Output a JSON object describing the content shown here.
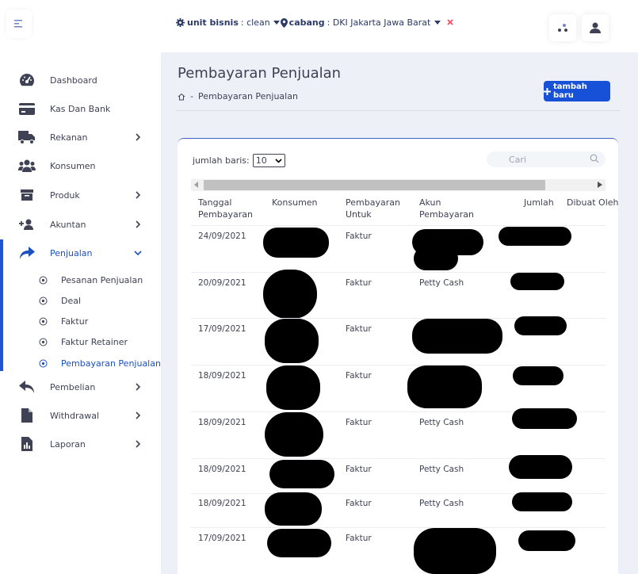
{
  "header": {
    "unit_label": "unit bisnis",
    "unit_value": ": clean",
    "cabang_label": "cabang",
    "cabang_value": ": DKI Jakarta Jawa Barat",
    "clear_icon": "x-icon",
    "apps_icon": "apps-icon",
    "user_icon": "user-icon"
  },
  "sidebar": {
    "toggle_icon": "menu-icon",
    "items": [
      {
        "label": "Dashboard",
        "icon": "gauge-icon"
      },
      {
        "label": "Kas Dan Bank",
        "icon": "card-icon"
      },
      {
        "label": "Rekanan",
        "icon": "truck-icon"
      },
      {
        "label": "Konsumen",
        "icon": "users-icon"
      },
      {
        "label": "Produk",
        "icon": "archive-icon"
      },
      {
        "label": "Akuntan",
        "icon": "user-plus-icon"
      },
      {
        "label": "Penjualan",
        "icon": "share-icon"
      },
      {
        "label": "Pembelian",
        "icon": "reply-icon"
      },
      {
        "label": "Withdrawal",
        "icon": "file-icon"
      },
      {
        "label": "Laporan",
        "icon": "report-icon"
      }
    ],
    "sub_items": [
      {
        "label": "Pesanan Penjualan"
      },
      {
        "label": "Deal"
      },
      {
        "label": "Faktur"
      },
      {
        "label": "Faktur Retainer"
      },
      {
        "label": "Pembayaran Penjualan"
      }
    ]
  },
  "page": {
    "title": "Pembayaran Penjualan",
    "breadcrumb": "Pembayaran Penjualan",
    "add_button": "tambah baru"
  },
  "table": {
    "rows_label": "jumlah baris:",
    "rows_value": "10",
    "search_placeholder": "Cari",
    "columns": {
      "tanggal": "Tanggal\nPembayaran",
      "konsumen": "Konsumen",
      "untuk": "Pembayaran\nUntuk",
      "akun": "Akun\nPembayaran",
      "jumlah": "Jumlah",
      "dibuat": "Dibuat Oleh"
    },
    "rows": [
      {
        "tanggal": "24/09/2021",
        "untuk": "Faktur",
        "akun": ""
      },
      {
        "tanggal": "20/09/2021",
        "untuk": "Faktur",
        "akun": "Petty Cash"
      },
      {
        "tanggal": "17/09/2021",
        "untuk": "Faktur",
        "akun": ""
      },
      {
        "tanggal": "18/09/2021",
        "untuk": "Faktur",
        "akun": ""
      },
      {
        "tanggal": "18/09/2021",
        "untuk": "Faktur",
        "akun": "Petty Cash"
      },
      {
        "tanggal": "18/09/2021",
        "untuk": "Faktur",
        "akun": "Petty Cash"
      },
      {
        "tanggal": "18/09/2021",
        "untuk": "Faktur",
        "akun": "Petty Cash"
      },
      {
        "tanggal": "17/09/2021",
        "untuk": "Faktur",
        "akun": ""
      }
    ]
  }
}
